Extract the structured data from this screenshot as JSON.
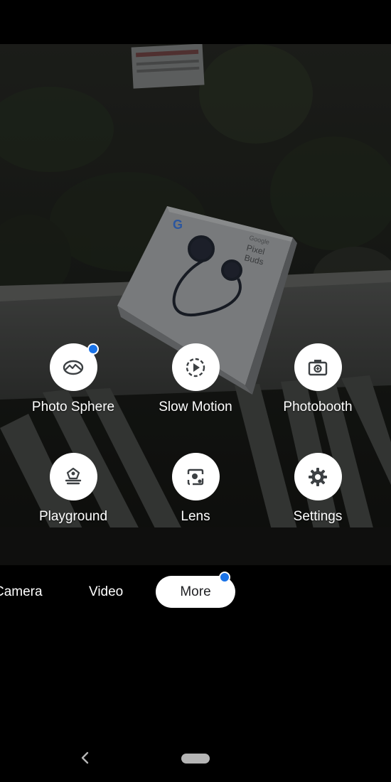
{
  "modes_grid": [
    {
      "label": "Photo Sphere",
      "icon": "photo-sphere-icon",
      "has_new_badge": true
    },
    {
      "label": "Slow Motion",
      "icon": "slow-motion-icon",
      "has_new_badge": false
    },
    {
      "label": "Photobooth",
      "icon": "photobooth-icon",
      "has_new_badge": false
    },
    {
      "label": "Playground",
      "icon": "playground-icon",
      "has_new_badge": false
    },
    {
      "label": "Lens",
      "icon": "lens-icon",
      "has_new_badge": false
    },
    {
      "label": "Settings",
      "icon": "settings-icon",
      "has_new_badge": false
    }
  ],
  "mode_bar": {
    "tabs": [
      "Camera",
      "Video",
      "More"
    ],
    "active_tab": "More",
    "more_has_badge": true
  },
  "viewfinder": {
    "box_brand": "G",
    "box_text_line1": "Google",
    "box_text_line2": "Pixel",
    "box_text_line3": "Buds"
  },
  "colors": {
    "badge": "#1a73e8",
    "active_tab_bg": "#ffffff",
    "background": "#000000"
  }
}
